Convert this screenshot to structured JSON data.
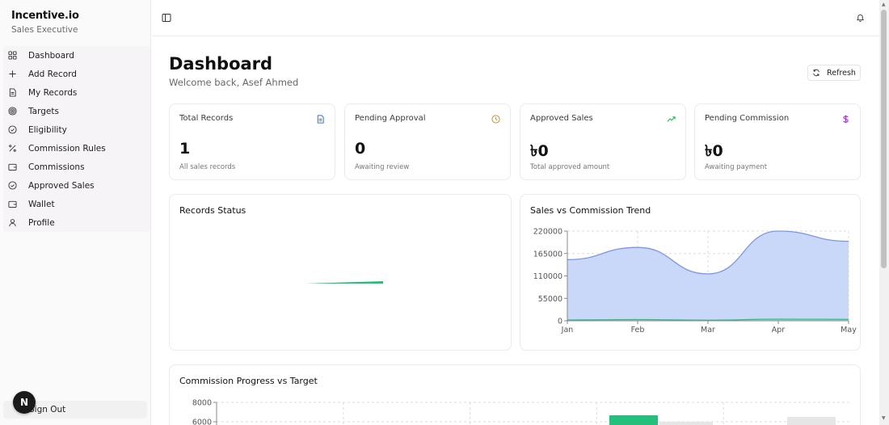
{
  "app": {
    "name": "Incentive.io",
    "role": "Sales Executive"
  },
  "sidebar": {
    "items": [
      {
        "label": "Dashboard",
        "icon": "grid-icon"
      },
      {
        "label": "Add Record",
        "icon": "plus-icon"
      },
      {
        "label": "My Records",
        "icon": "file-icon"
      },
      {
        "label": "Targets",
        "icon": "target-icon"
      },
      {
        "label": "Eligibility",
        "icon": "check-circle-icon"
      },
      {
        "label": "Commission Rules",
        "icon": "percent-icon"
      },
      {
        "label": "Commissions",
        "icon": "wallet-icon"
      },
      {
        "label": "Approved Sales",
        "icon": "check-circle-icon"
      },
      {
        "label": "Wallet",
        "icon": "wallet-icon"
      },
      {
        "label": "Profile",
        "icon": "user-icon"
      }
    ],
    "sign_out": "Sign Out",
    "avatar_letter": "N"
  },
  "header": {
    "title": "Dashboard",
    "welcome": "Welcome back, Asef Ahmed",
    "refresh_label": "Refresh"
  },
  "cards": [
    {
      "title": "Total Records",
      "value": "1",
      "sub": "All sales records",
      "icon": "file-icon",
      "color": "#3b6fe0"
    },
    {
      "title": "Pending Approval",
      "value": "0",
      "sub": "Awaiting review",
      "icon": "clock-icon",
      "color": "#e08a1e"
    },
    {
      "title": "Approved Sales",
      "value": "৳0",
      "sub": "Total approved amount",
      "icon": "trending-up-icon",
      "color": "#22b35a"
    },
    {
      "title": "Pending Commission",
      "value": "৳0",
      "sub": "Awaiting payment",
      "icon": "dollar-icon",
      "color": "#9b30d9"
    }
  ],
  "panels": {
    "records_status": "Records Status",
    "trend": "Sales vs Commission Trend",
    "progress": "Commission Progress vs Target"
  },
  "chart_data": [
    {
      "type": "pie",
      "title": "Records Status",
      "slices": [
        {
          "value": 1,
          "color": "#22c07a"
        }
      ]
    },
    {
      "type": "area",
      "title": "Sales vs Commission Trend",
      "categories": [
        "Jan",
        "Feb",
        "Mar",
        "Apr",
        "May"
      ],
      "series": [
        {
          "values": [
            150000,
            180000,
            115000,
            220000,
            195000
          ],
          "color": "#7b97e6",
          "fill": "#c6d5f8"
        },
        {
          "values": [
            2000,
            3000,
            1500,
            4000,
            3500
          ],
          "color": "#2bbf86",
          "fill": "#9fe0c6"
        }
      ],
      "yticks": [
        "0",
        "55000",
        "110000",
        "165000",
        "220000"
      ],
      "ylim": [
        0,
        220000
      ],
      "grid": true
    },
    {
      "type": "bar",
      "title": "Commission Progress vs Target",
      "yticks_visible": [
        "6000",
        "8000"
      ],
      "colors": {
        "achieved": "#22c07a",
        "target": "#e6e6e6"
      }
    }
  ]
}
